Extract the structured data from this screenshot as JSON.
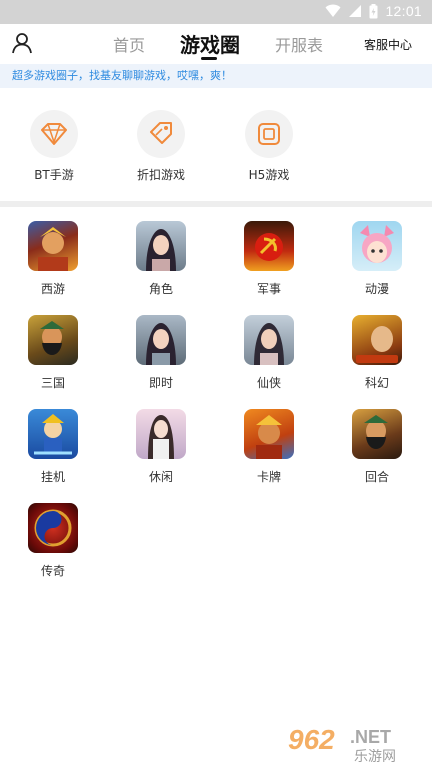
{
  "status": {
    "time": "12:01"
  },
  "nav": {
    "home": "首页",
    "circle": "游戏圈",
    "schedule": "开服表",
    "service": "客服中心"
  },
  "notice": "超多游戏圈子，找基友聊聊游戏，哎嘿，爽！",
  "quick": [
    {
      "label": "BT手游",
      "icon": "diamond-icon"
    },
    {
      "label": "折扣游戏",
      "icon": "discount-tag-icon"
    },
    {
      "label": "H5游戏",
      "icon": "h5-screen-icon"
    }
  ],
  "categories": [
    {
      "label": "西游"
    },
    {
      "label": "角色"
    },
    {
      "label": "军事"
    },
    {
      "label": "动漫"
    },
    {
      "label": "三国"
    },
    {
      "label": "即时"
    },
    {
      "label": "仙侠"
    },
    {
      "label": "科幻"
    },
    {
      "label": "挂机"
    },
    {
      "label": "休闲"
    },
    {
      "label": "卡牌"
    },
    {
      "label": "回合"
    },
    {
      "label": "传奇"
    }
  ],
  "watermark": {
    "number": "962",
    "suffix": ".NET",
    "sub": "乐游网"
  },
  "colors": {
    "accent": "#f08a3c",
    "notice_text": "#2f8be0",
    "notice_bg": "#edf3fb"
  }
}
